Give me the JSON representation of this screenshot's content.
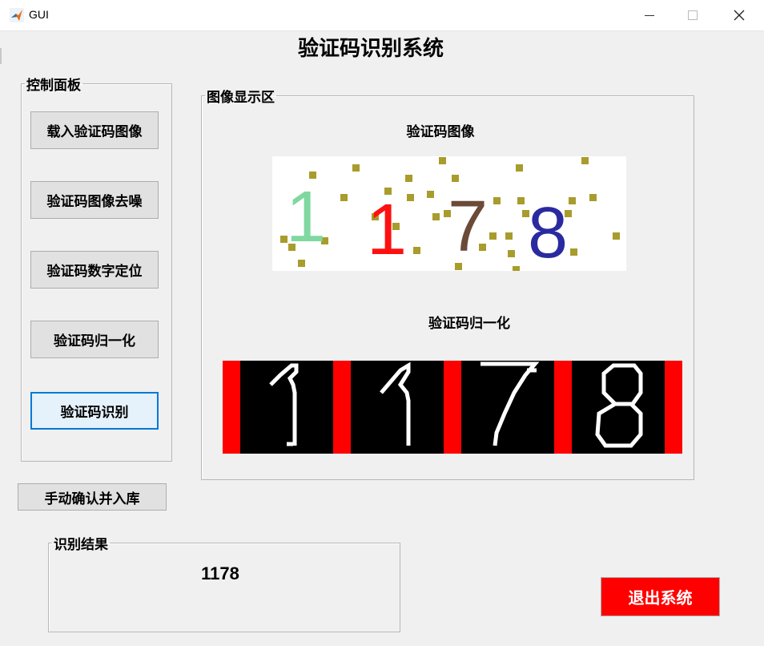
{
  "window": {
    "title": "GUI"
  },
  "app": {
    "title": "验证码识别系统"
  },
  "control_panel": {
    "legend": "控制面板",
    "buttons": [
      "载入验证码图像",
      "验证码图像去噪",
      "验证码数字定位",
      "验证码归一化",
      "验证码识别"
    ]
  },
  "manual_button": "手动确认并入库",
  "image_panel": {
    "legend": "图像显示区",
    "captcha_title": "验证码图像",
    "normalized_title": "验证码归一化",
    "captcha_digits": [
      "1",
      "1",
      "7",
      "8"
    ],
    "normalized_digits": [
      "1",
      "1",
      "7",
      "8"
    ]
  },
  "result_panel": {
    "legend": "识别结果",
    "value": "1178"
  },
  "exit_button": "退出系统",
  "colors": {
    "exit_bg": "#ff0000",
    "digit1": "#7fd8a0",
    "digit2": "#ff1010",
    "digit3": "#6b4a38",
    "digit4": "#2a2aa0",
    "noise": "#a89c2c",
    "norm_separator": "#ff0000"
  }
}
